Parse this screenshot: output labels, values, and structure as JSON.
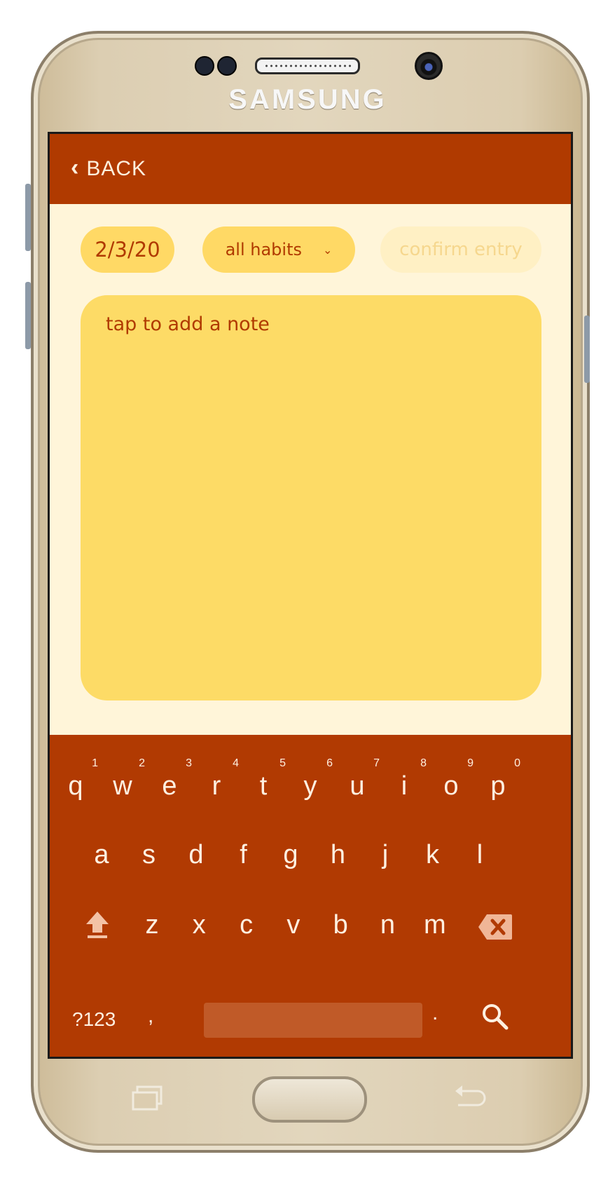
{
  "device": {
    "brand": "SAMSUNG"
  },
  "appbar": {
    "back_label": "BACK"
  },
  "controls": {
    "date": "2/3/20",
    "habit_filter": "all habits",
    "confirm_label": "confirm entry"
  },
  "note": {
    "placeholder": "tap to add a note"
  },
  "keyboard": {
    "row1": [
      {
        "key": "q",
        "num": "1"
      },
      {
        "key": "w",
        "num": "2"
      },
      {
        "key": "e",
        "num": "3"
      },
      {
        "key": "r",
        "num": "4"
      },
      {
        "key": "t",
        "num": "5"
      },
      {
        "key": "y",
        "num": "6"
      },
      {
        "key": "u",
        "num": "7"
      },
      {
        "key": "i",
        "num": "8"
      },
      {
        "key": "o",
        "num": "9"
      },
      {
        "key": "p",
        "num": "0"
      }
    ],
    "row2": [
      "a",
      "s",
      "d",
      "f",
      "g",
      "h",
      "j",
      "k",
      "l"
    ],
    "row3": [
      "z",
      "x",
      "c",
      "v",
      "b",
      "n",
      "m"
    ],
    "symbols_label": "?123",
    "comma": ",",
    "period": "."
  },
  "colors": {
    "primary": "#b03a00",
    "accent": "#ffd965",
    "background": "#fff5d9"
  }
}
